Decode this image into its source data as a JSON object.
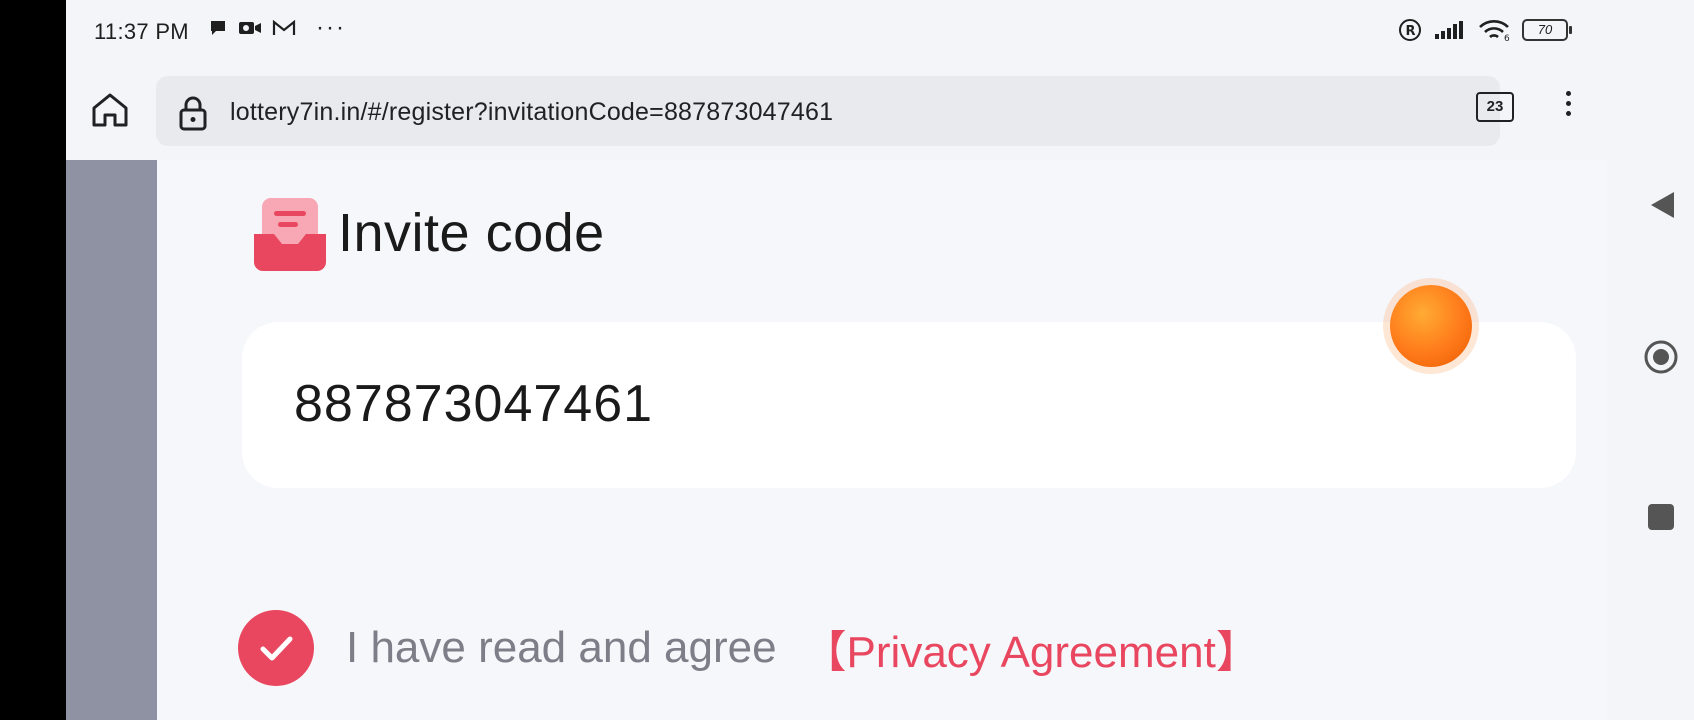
{
  "status_bar": {
    "time": "11:37 PM",
    "more": "···",
    "battery": "70",
    "icons": [
      "chat-icon",
      "video-icon",
      "gmail-icon",
      "registered-icon",
      "signal-icon",
      "wifi-icon",
      "battery-icon"
    ]
  },
  "browser": {
    "url": "lottery7in.in/#/register?invitationCode=887873047461",
    "tab_count": "23"
  },
  "page": {
    "invite_title": "Invite code",
    "invite_code_value": "887873047461",
    "agree_text": "I have read and agree",
    "privacy_link": "【Privacy Agreement】"
  },
  "colors": {
    "accent": "#e8475f",
    "sidebar": "#8e92a3",
    "floating_ball": "#ff7a1a"
  }
}
